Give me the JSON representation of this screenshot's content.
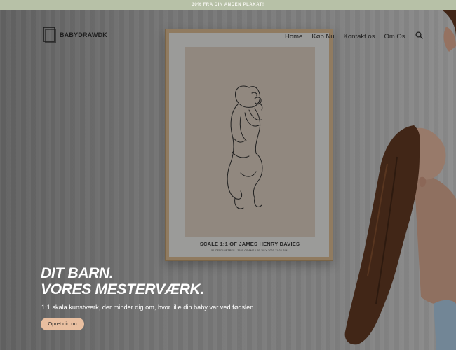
{
  "announcement": {
    "text": "30% FRA DIN ANDEN PLAKAT!"
  },
  "header": {
    "logo_text": "BABYDRAWDK",
    "nav": [
      {
        "label": "Home"
      },
      {
        "label": "Køb Nu"
      },
      {
        "label": "Kontakt os"
      },
      {
        "label": "Om Os"
      }
    ],
    "search_icon": "search-icon"
  },
  "poster": {
    "title": "SCALE 1:1 OF  JAMES HENRY DAVIES",
    "subtitle": "51  CENTIMETRES / 3550 GRAMS / 20 JULY 2020 11:28 P.M."
  },
  "hero": {
    "headline_line1": "DIT BARN.",
    "headline_line2": "VORES MESTERVÆRK.",
    "subtext": "1:1 skala kunstværk, der minder dig om, hvor lille din baby var ved fødslen.",
    "cta_label": "Opret din nu"
  },
  "colors": {
    "announcement_bg": "#b7c1a7",
    "cta_bg": "#e9bfa0",
    "overlay": "rgba(0,0,0,0.28)"
  }
}
